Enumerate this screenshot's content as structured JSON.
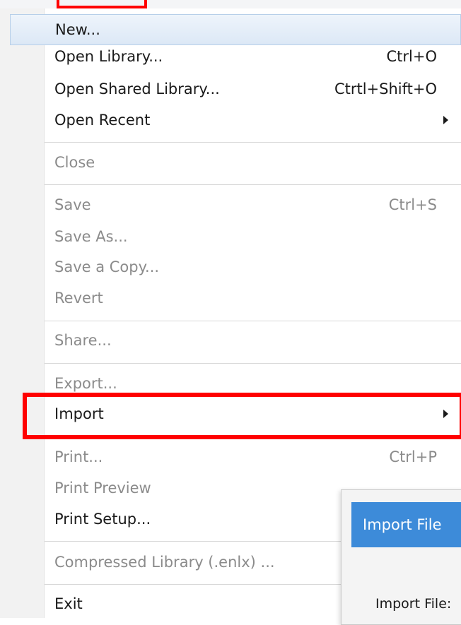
{
  "menu": {
    "items": [
      {
        "label": "New...",
        "shortcut": "",
        "submenu": false,
        "disabled": false
      },
      {
        "label": "Open Library...",
        "shortcut": "Ctrl+O",
        "submenu": false,
        "disabled": false
      },
      {
        "label": "Open Shared Library...",
        "shortcut": "Ctrtl+Shift+O",
        "submenu": false,
        "disabled": false
      },
      {
        "label": "Open Recent",
        "shortcut": "",
        "submenu": true,
        "disabled": false
      },
      {
        "label": "Close",
        "shortcut": "",
        "submenu": false,
        "disabled": true
      },
      {
        "label": "Save",
        "shortcut": "Ctrl+S",
        "submenu": false,
        "disabled": true
      },
      {
        "label": "Save As...",
        "shortcut": "",
        "submenu": false,
        "disabled": true
      },
      {
        "label": "Save a Copy...",
        "shortcut": "",
        "submenu": false,
        "disabled": true
      },
      {
        "label": "Revert",
        "shortcut": "",
        "submenu": false,
        "disabled": true
      },
      {
        "label": "Share...",
        "shortcut": "",
        "submenu": false,
        "disabled": true
      },
      {
        "label": "Export...",
        "shortcut": "",
        "submenu": false,
        "disabled": true
      },
      {
        "label": "Import",
        "shortcut": "",
        "submenu": true,
        "disabled": false
      },
      {
        "label": "Print...",
        "shortcut": "Ctrl+P",
        "submenu": false,
        "disabled": true
      },
      {
        "label": "Print Preview",
        "shortcut": "",
        "submenu": false,
        "disabled": true
      },
      {
        "label": "Print Setup...",
        "shortcut": "",
        "submenu": false,
        "disabled": false
      },
      {
        "label": "Compressed Library (.enlx) ...",
        "shortcut": "",
        "submenu": false,
        "disabled": true
      },
      {
        "label": "Exit",
        "shortcut": "",
        "submenu": false,
        "disabled": false
      }
    ]
  },
  "dialog": {
    "title": "Import File",
    "field_label": "Import File:"
  },
  "colors": {
    "highlight": "#ff0000",
    "dialog_titlebar": "#3d8bd9",
    "disabled_text": "#8b8b8b"
  }
}
